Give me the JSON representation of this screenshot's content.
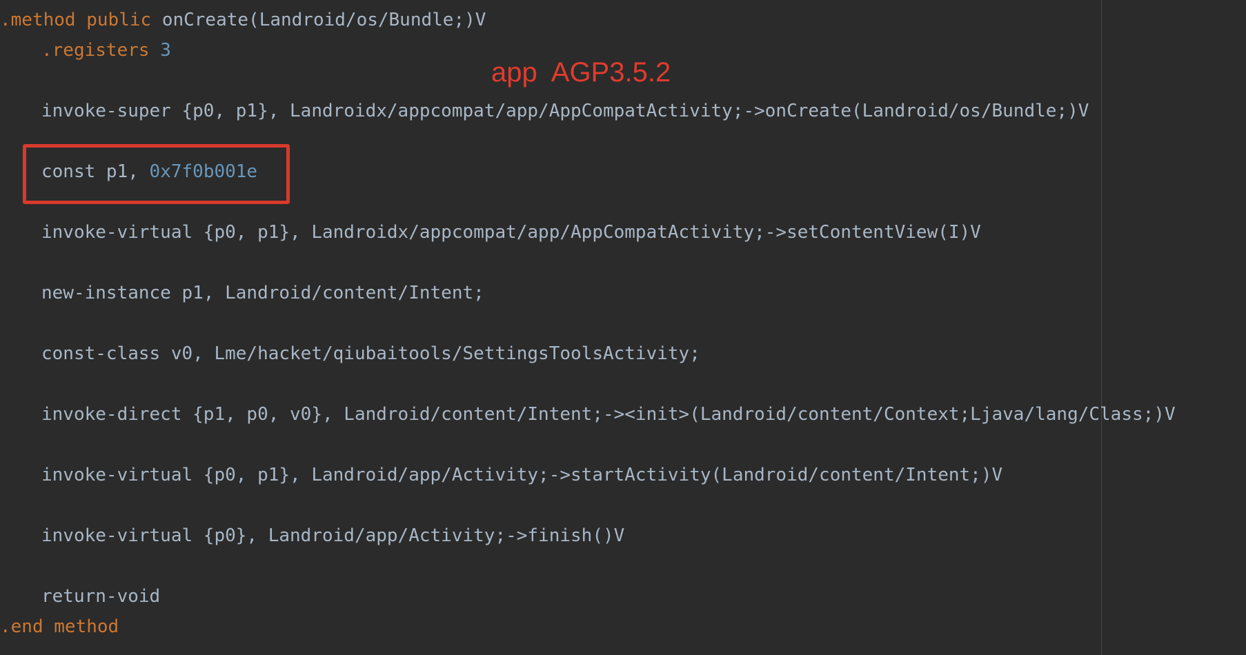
{
  "code": {
    "method_header": {
      "directive": ".method",
      "modifier": "public",
      "signature": "onCreate(Landroid/os/Bundle;)V"
    },
    "registers": {
      "directive": ".registers",
      "count": "3"
    },
    "lines": {
      "invoke_super": "invoke-super {p0, p1}, Landroidx/appcompat/app/AppCompatActivity;->onCreate(Landroid/os/Bundle;)V",
      "const_prefix": "const p1, ",
      "const_value": "0x7f0b001e",
      "invoke_virtual_setcontent": "invoke-virtual {p0, p1}, Landroidx/appcompat/app/AppCompatActivity;->setContentView(I)V",
      "new_instance": "new-instance p1, Landroid/content/Intent;",
      "const_class": "const-class v0, Lme/hacket/qiubaitools/SettingsToolsActivity;",
      "invoke_direct": "invoke-direct {p1, p0, v0}, Landroid/content/Intent;-><init>(Landroid/content/Context;Ljava/lang/Class;)V",
      "invoke_virtual_start": "invoke-virtual {p0, p1}, Landroid/app/Activity;->startActivity(Landroid/content/Intent;)V",
      "invoke_virtual_finish": "invoke-virtual {p0}, Landroid/app/Activity;->finish()V",
      "return_void": "return-void"
    },
    "method_footer": {
      "directive": ".end",
      "keyword": "method"
    }
  },
  "annotation": {
    "title": "app  AGP3.5.2",
    "color": "#e03c2e"
  },
  "colors": {
    "background": "#2b2b2b",
    "text": "#a9b7c6",
    "keyword": "#cc7832",
    "number": "#6897bb",
    "highlight_box": "#d83a2c"
  }
}
